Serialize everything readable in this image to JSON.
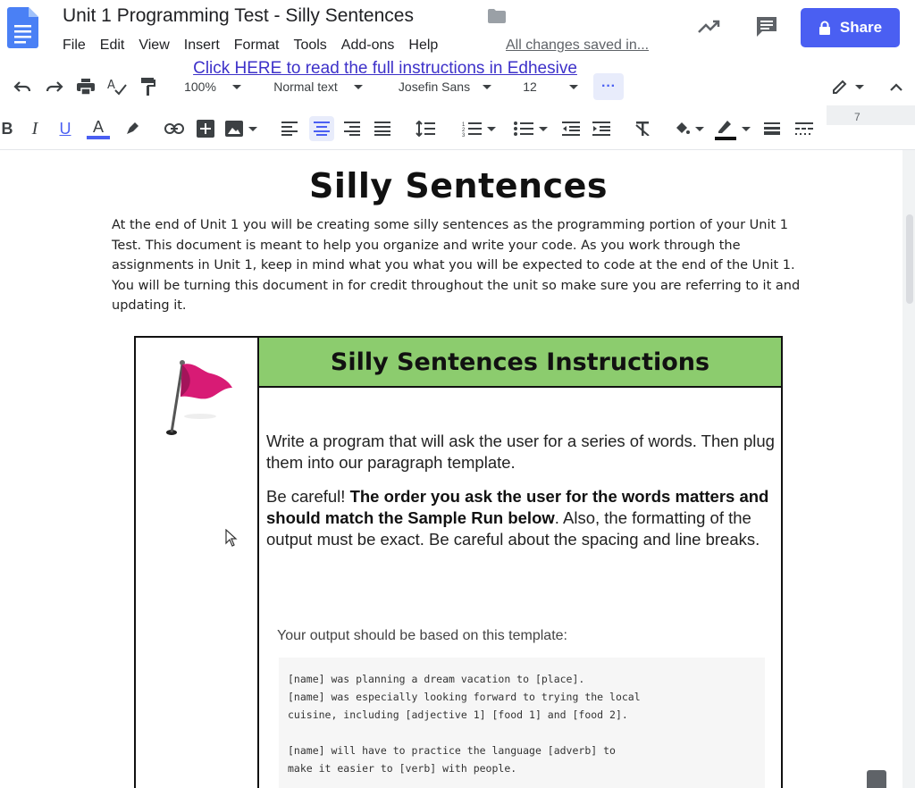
{
  "header": {
    "title": "Unit 1 Programming Test - Silly Sentences",
    "menu": [
      "File",
      "Edit",
      "View",
      "Insert",
      "Format",
      "Tools",
      "Add-ons",
      "Help"
    ],
    "saved_status": "All changes saved in...",
    "share_label": "Share",
    "accent_color": "#4a5ff2"
  },
  "toolbar": {
    "zoom": "100%",
    "style": "Normal text",
    "font": "Josefin Sans",
    "font_size": "12",
    "more": "···",
    "ruler_marker": "7",
    "icons": [
      "undo-icon",
      "redo-icon",
      "print-icon",
      "spellcheck-icon",
      "paint-format-icon",
      "bold-icon",
      "italic-icon",
      "underline-icon",
      "text-color-icon",
      "highlight-icon",
      "link-icon",
      "insert-comment-icon",
      "image-icon",
      "align-left-icon",
      "align-center-icon",
      "align-right-icon",
      "justify-icon",
      "line-spacing-icon",
      "numbered-list-icon",
      "bulleted-list-icon",
      "decrease-indent-icon",
      "increase-indent-icon",
      "clear-formatting-icon",
      "fill-color-icon",
      "border-color-icon",
      "border-width-icon",
      "border-dash-icon",
      "edit-mode-icon",
      "collapse-icon"
    ]
  },
  "document": {
    "heading": "Silly Sentences",
    "intro": "At the end of Unit 1 you will be creating some silly sentences as the programming portion of your Unit 1 Test.  This document is meant to help you organize and write your code.  As you work through the assignments in Unit 1, keep in mind what you what you will be expected to code at the end of the Unit 1. You will be turning this document in for credit throughout the unit so make sure you are referring to it and updating it.",
    "table": {
      "heading": "Silly Sentences Instructions",
      "link_text": "Click HERE to read the full instructions in Edhesive",
      "para1": "Write a program that will ask the user for a series of words. Then plug them into our paragraph template.",
      "para2_start": "Be careful! ",
      "para2_bold": "The order you ask the user for the words matters and should match the Sample Run below",
      "para2_end": ". Also, the formatting of the output must be exact. Be careful about the spacing and line breaks.",
      "template_label": "Your output should be based on this template:",
      "template_code": "[name] was planning a dream vacation to [place].\n[name] was especially looking forward to trying the local\ncuisine, including [adjective 1] [food 1] and [food 2].\n\n[name] will have to practice the language [adverb] to\nmake it easier to [verb] with people."
    }
  }
}
